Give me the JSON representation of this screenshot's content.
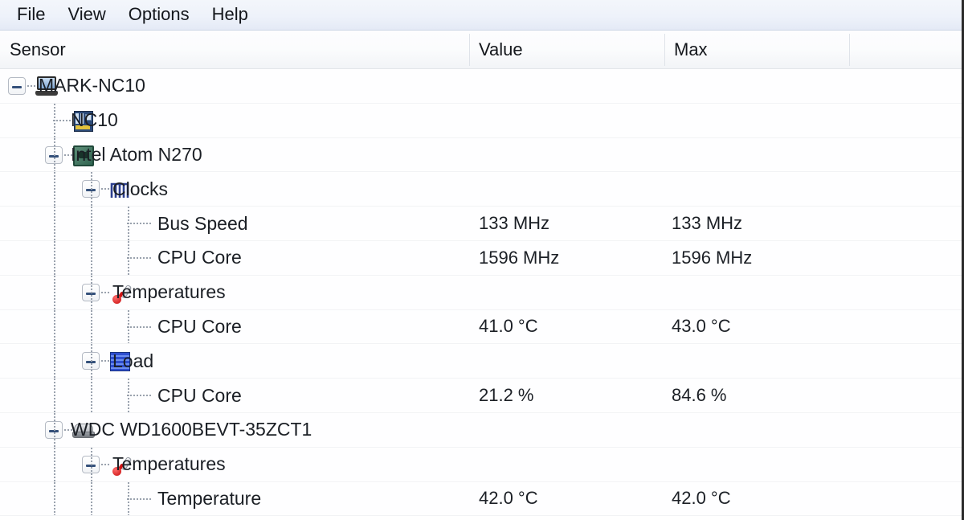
{
  "app": {
    "menu": [
      {
        "label": "File",
        "name": "menu-file"
      },
      {
        "label": "View",
        "name": "menu-view"
      },
      {
        "label": "Options",
        "name": "menu-options"
      },
      {
        "label": "Help",
        "name": "menu-help"
      }
    ],
    "columns": {
      "sensor": "Sensor",
      "value": "Value",
      "max": "Max"
    },
    "rows": [
      {
        "label": "MARK-NC10",
        "value": "",
        "max": "",
        "level": 0,
        "icon": "laptop-icon",
        "expander": "minus",
        "name": "tree-item-mark-nc10"
      },
      {
        "label": "NC10",
        "value": "",
        "max": "",
        "level": 1,
        "icon": "motherboard-icon",
        "expander": "none",
        "name": "tree-item-nc10"
      },
      {
        "label": "Intel Atom N270",
        "value": "",
        "max": "",
        "level": 1,
        "icon": "cpu-icon",
        "expander": "minus",
        "name": "tree-item-intel-atom-n270"
      },
      {
        "label": "Clocks",
        "value": "",
        "max": "",
        "level": 2,
        "icon": "clock-pulse-icon",
        "expander": "minus",
        "name": "tree-item-clocks"
      },
      {
        "label": "Bus Speed",
        "value": "133 MHz",
        "max": "133 MHz",
        "level": 3,
        "icon": "none",
        "expander": "none",
        "name": "tree-item-bus-speed"
      },
      {
        "label": "CPU Core",
        "value": "1596 MHz",
        "max": "1596 MHz",
        "level": 3,
        "icon": "none",
        "expander": "none",
        "name": "tree-item-cpu-core-clock"
      },
      {
        "label": "Temperatures",
        "value": "",
        "max": "",
        "level": 2,
        "icon": "thermometer-icon",
        "expander": "minus",
        "name": "tree-item-cpu-temperatures"
      },
      {
        "label": "CPU Core",
        "value": "41.0 °C",
        "max": "43.0 °C",
        "level": 3,
        "icon": "none",
        "expander": "none",
        "name": "tree-item-cpu-core-temperature"
      },
      {
        "label": "Load",
        "value": "",
        "max": "",
        "level": 2,
        "icon": "load-bars-icon",
        "expander": "minus",
        "name": "tree-item-load"
      },
      {
        "label": "CPU Core",
        "value": "21.2 %",
        "max": "84.6 %",
        "level": 3,
        "icon": "none",
        "expander": "none",
        "name": "tree-item-cpu-core-load"
      },
      {
        "label": "WDC WD1600BEVT-35ZCT1",
        "value": "",
        "max": "",
        "level": 1,
        "icon": "harddisk-icon",
        "expander": "minus",
        "name": "tree-item-wdc-wd1600bevt"
      },
      {
        "label": "Temperatures",
        "value": "",
        "max": "",
        "level": 2,
        "icon": "thermometer-icon",
        "expander": "minus",
        "name": "tree-item-hdd-temperatures"
      },
      {
        "label": "Temperature",
        "value": "42.0 °C",
        "max": "42.0 °C",
        "level": 3,
        "icon": "none",
        "expander": "none",
        "name": "tree-item-hdd-temperature"
      }
    ]
  }
}
